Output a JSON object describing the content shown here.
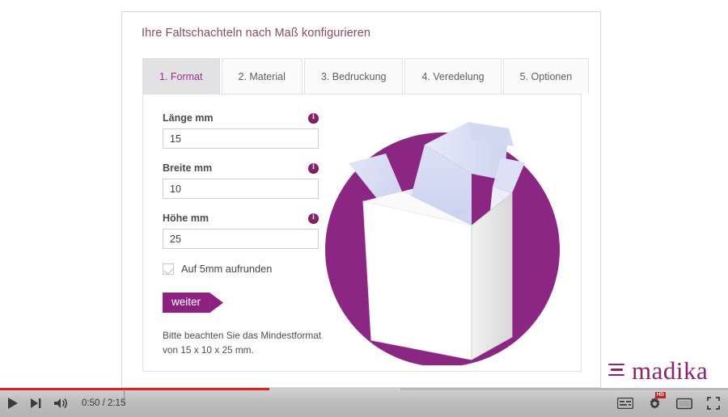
{
  "card": {
    "title": "Ihre Faltschachteln nach Maß konfigurieren",
    "tabs": [
      {
        "label": "1. Format",
        "active": true
      },
      {
        "label": "2. Material",
        "active": false
      },
      {
        "label": "3. Bedruckung",
        "active": false
      },
      {
        "label": "4. Veredelung",
        "active": false
      },
      {
        "label": "5. Optionen",
        "active": false
      }
    ],
    "form": {
      "fields": [
        {
          "label": "Länge mm",
          "value": "15",
          "info": "info-icon"
        },
        {
          "label": "Breite mm",
          "value": "10",
          "info": "info-icon"
        },
        {
          "label": "Höhe mm",
          "value": "25",
          "info": "info-icon"
        }
      ],
      "checkbox": {
        "label": "Auf 5mm aufrunden",
        "checked": true
      },
      "submit_label": "weiter",
      "hint_line1": "Bitte beachten Sie das Mindestformat",
      "hint_line2": "von 15 x 10 x 25 mm."
    },
    "illustration": {
      "name": "folding-box-illustration",
      "circle_color": "#8B2782",
      "box_front_color": "#FFFFFF",
      "box_flap_color": "#D7DCF2"
    }
  },
  "logo": {
    "mark": "three-bars-icon",
    "text": "madika",
    "color": "#8E2170"
  },
  "player": {
    "play_label": "play-icon",
    "next_label": "next-icon",
    "volume_label": "volume-icon",
    "time": "0:50 / 2:15",
    "current_time": "0:50",
    "duration": "2:15",
    "progress_percent": 37,
    "buffer_percent": 55,
    "subtitles_label": "subtitles-icon",
    "settings_label": "settings-gear-icon",
    "quality_badge": "HD",
    "theater_label": "theater-mode-icon",
    "fullscreen_label": "fullscreen-icon",
    "accent_color": "#E02020"
  }
}
